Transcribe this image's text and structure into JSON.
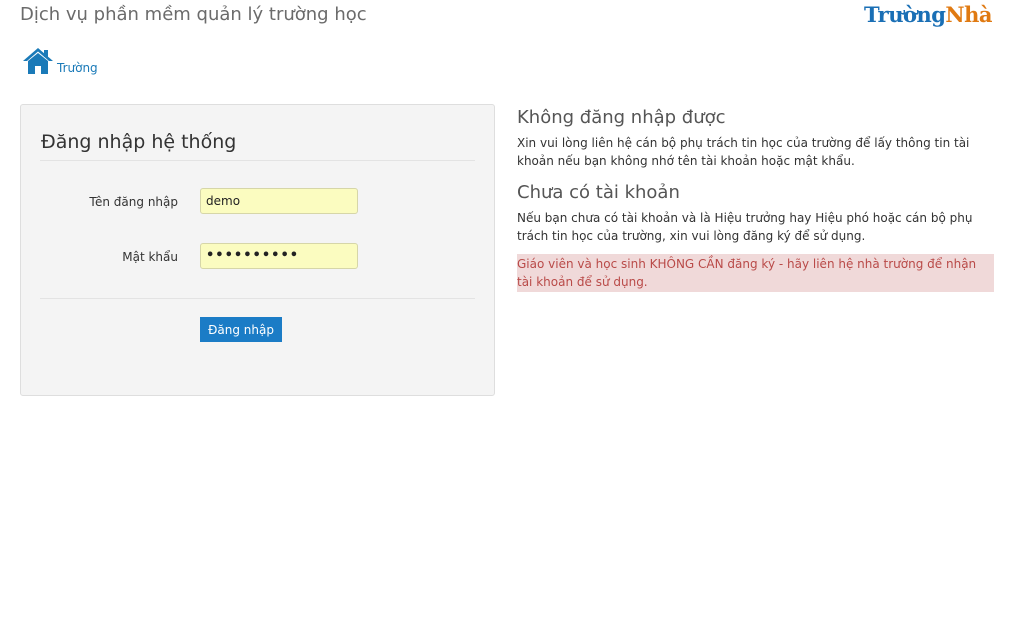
{
  "header": {
    "title": "Dịch vụ phần mềm quản lý trường học",
    "logo_part1": "Trường",
    "logo_part2": "Nhà",
    "brand_colors": {
      "primary": "#1a6fb5",
      "secondary": "#e07a12"
    }
  },
  "breadcrumb": {
    "icon": "home-icon",
    "label": "Trường"
  },
  "login": {
    "title": "Đăng nhập hệ thống",
    "username_label": "Tên đăng nhập",
    "username_value": "demo",
    "password_label": "Mật khẩu",
    "password_display": "••••••••••",
    "submit_label": "Đăng nhập"
  },
  "help": {
    "cannot_login_title": "Không đăng nhập được",
    "cannot_login_text": "Xin vui lòng liên hệ cán bộ phụ trách tin học của trường để lấy thông tin tài khoản nếu bạn không nhớ tên tài khoản hoặc mật khẩu.",
    "no_account_title": "Chưa có tài khoản",
    "no_account_text": "Nếu bạn chưa có tài khoản và là Hiệu trưởng hay Hiệu phó hoặc cán bộ phụ trách tin học của trường, xin vui lòng đăng ký để sử dụng.",
    "warning_text": "Giáo viên và học sinh KHÔNG CẦN đăng ký - hãy liên hệ nhà trường để nhận tài khoản để sử dụng."
  }
}
